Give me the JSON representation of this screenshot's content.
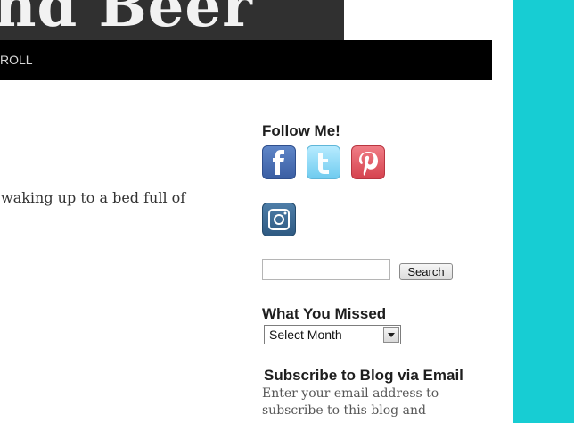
{
  "header": {
    "title": "nd Beer"
  },
  "nav": {
    "partial_item": "ROLL"
  },
  "post": {
    "snippet": "waking up to a bed full of"
  },
  "sidebar": {
    "follow": {
      "title": "Follow Me!",
      "icons": [
        "facebook-icon",
        "twitter-icon",
        "pinterest-icon",
        "instagram-icon"
      ]
    },
    "search": {
      "button_label": "Search",
      "value": ""
    },
    "archive": {
      "title": "What You Missed",
      "selected": "Select Month"
    },
    "subscribe": {
      "title": "Subscribe to Blog via Email",
      "text": "Enter your email address to subscribe to this blog and"
    }
  },
  "colors": {
    "teal": "#17cdd3",
    "nav_bg": "#000000",
    "banner_bg": "#303030"
  }
}
